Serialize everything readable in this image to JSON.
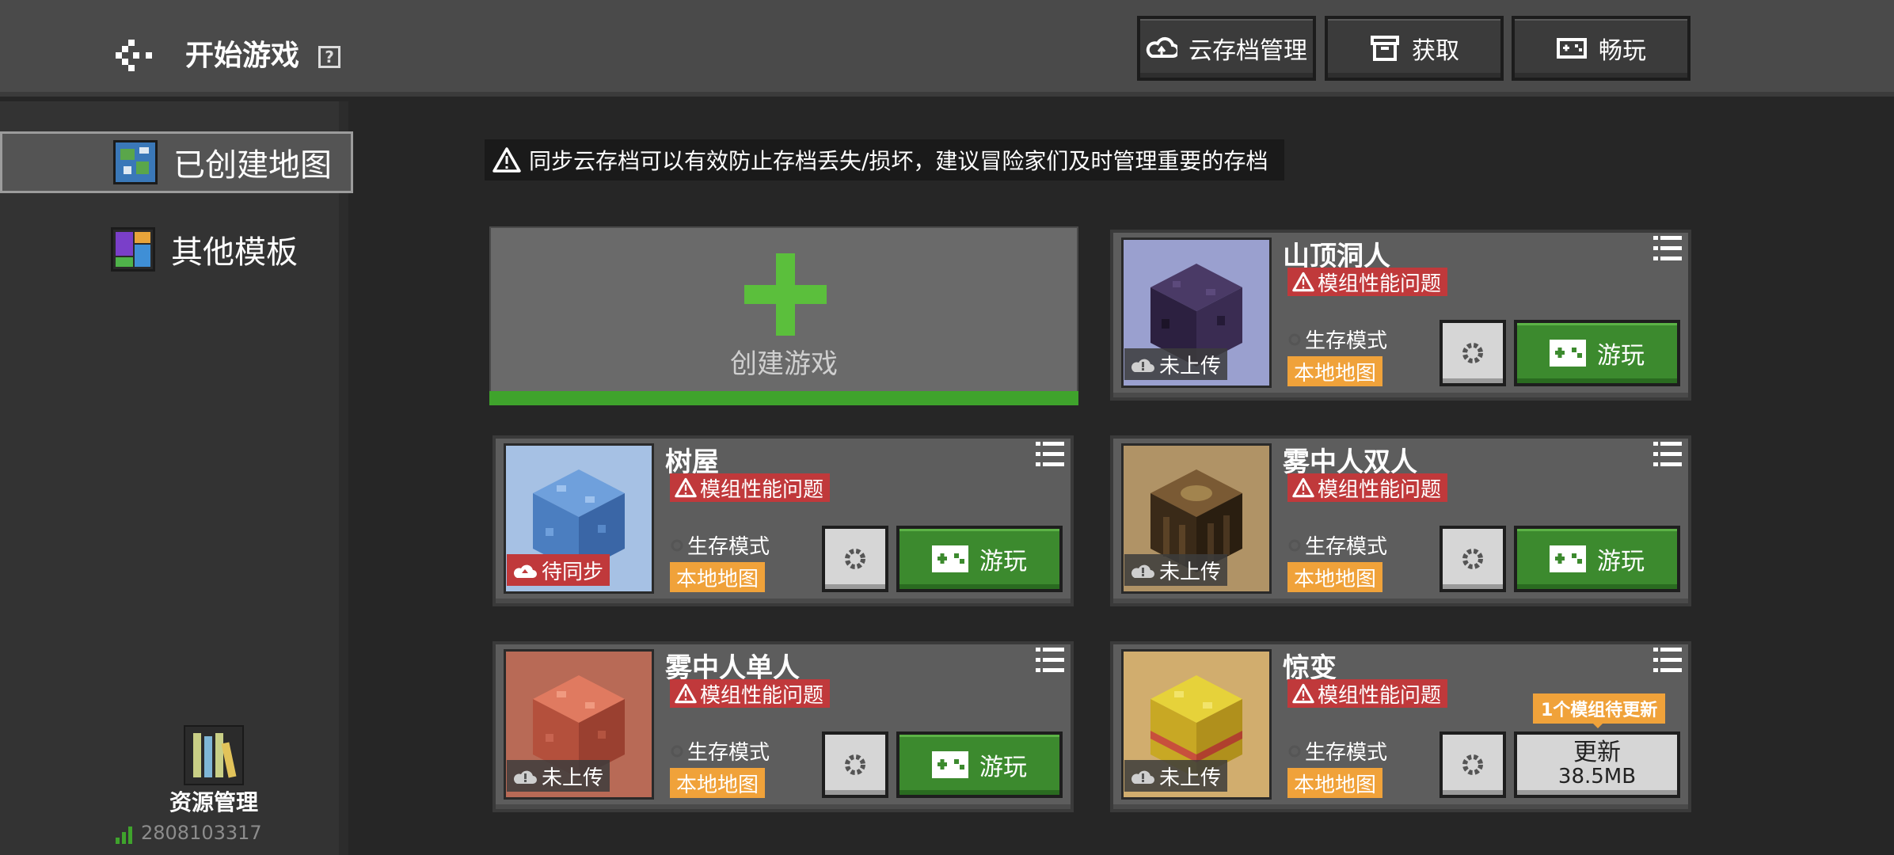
{
  "header": {
    "title": "开始游戏",
    "help_label": "?",
    "buttons": [
      {
        "label": "云存档管理",
        "icon": "cloud-sync-icon"
      },
      {
        "label": "获取",
        "icon": "chest-icon"
      },
      {
        "label": "畅玩",
        "icon": "gamepad-icon"
      }
    ]
  },
  "sidebar": {
    "items": [
      {
        "label": "已创建地图",
        "icon": "world-globe-icon",
        "selected": true
      },
      {
        "label": "其他模板",
        "icon": "template-icon",
        "selected": false
      }
    ],
    "resource_label": "资源管理",
    "user_id": "2808103317"
  },
  "notice": "同步云存档可以有效防止存档丢失/损坏，建议冒险家们及时管理重要的存档",
  "create": {
    "label": "创建游戏"
  },
  "worlds": [
    {
      "name": "山顶洞人",
      "warning": "模组性能问题",
      "mode": "生存模式",
      "location": "本地地图",
      "sync": "未上传",
      "action": "游玩"
    },
    {
      "name": "树屋",
      "warning": "模组性能问题",
      "mode": "生存模式",
      "location": "本地地图",
      "sync": "待同步",
      "action": "游玩"
    },
    {
      "name": "雾中人双人",
      "warning": "模组性能问题",
      "mode": "生存模式",
      "location": "本地地图",
      "sync": "未上传",
      "action": "游玩"
    },
    {
      "name": "雾中人单人",
      "warning": "模组性能问题",
      "mode": "生存模式",
      "location": "本地地图",
      "sync": "未上传",
      "action": "游玩"
    },
    {
      "name": "惊变",
      "warning": "模组性能问题",
      "mode": "生存模式",
      "location": "本地地图",
      "sync": "未上传",
      "update_notice": "1个模组待更新",
      "update_label": "更新",
      "update_size": "38.5MB"
    }
  ],
  "colors": {
    "play_green": "#3c8a2e",
    "warning_red": "#c0393b",
    "local_orange": "#f0a23a",
    "create_green": "#3fa32c"
  }
}
